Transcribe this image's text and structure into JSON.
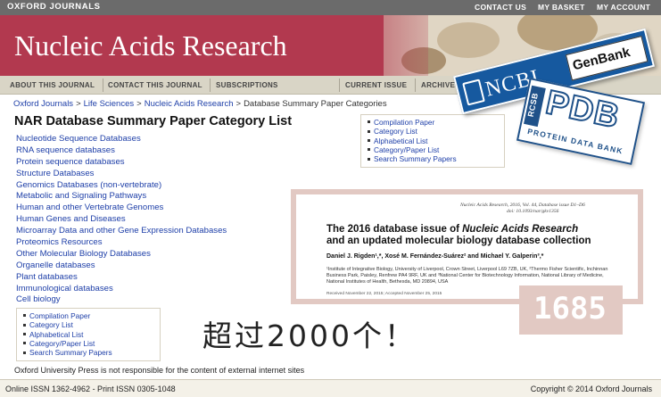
{
  "top_bar": {
    "brand": "OXFORD JOURNALS",
    "links": [
      "CONTACT US",
      "MY BASKET",
      "MY ACCOUNT"
    ]
  },
  "banner": {
    "journal_title": "Nucleic Acids Research"
  },
  "nav_bar": {
    "items": [
      "ABOUT THIS JOURNAL",
      "CONTACT THIS JOURNAL",
      "SUBSCRIPTIONS",
      "CURRENT ISSUE",
      "ARCHIVE"
    ]
  },
  "breadcrumb": {
    "items": [
      "Oxford Journals",
      "Life Sciences",
      "Nucleic Acids Research"
    ],
    "current": "Database Summary Paper Categories",
    "separator": ">"
  },
  "page_title": "NAR Database Summary Paper Category List",
  "categories": [
    "Nucleotide Sequence Databases",
    "RNA sequence databases",
    "Protein sequence databases",
    "Structure Databases",
    "Genomics Databases (non-vertebrate)",
    "Metabolic and Signaling Pathways",
    "Human and other Vertebrate Genomes",
    "Human Genes and Diseases",
    "Microarray Data and other Gene Expression Databases",
    "Proteomics Resources",
    "Other Molecular Biology Databases",
    "Organelle databases",
    "Plant databases",
    "Immunological databases",
    "Cell biology"
  ],
  "quick_links": [
    "Compilation Paper",
    "Category List",
    "Alphabetical List",
    "Category/Paper List",
    "Search Summary Papers"
  ],
  "disclaimer": "Oxford University Press is not responsible for the content of external internet sites",
  "footer": {
    "issn": "Online ISSN 1362-4962 - Print ISSN 0305-1048",
    "copyright": "Copyright © 2014 Oxford Journals"
  },
  "logos": {
    "ncbi": "NCBI",
    "genbank": "GenBank",
    "pdb": "PDB",
    "rcsb": "RCSB",
    "pdb_subtitle": "PROTEIN DATA BANK"
  },
  "paper_excerpt": {
    "header_line1": "Nucleic Acids Research, 2016, Vol. 44, Database issue    D1–D6",
    "header_line2": "doi: 10.1093/nar/gkv1356",
    "title_pre": "The 2016 database issue of ",
    "title_journal": "Nucleic Acids Research",
    "title_line2": "and an updated molecular biology database collection",
    "authors": "Daniel J. Rigden¹,*, Xosé M. Fernández-Suárez² and Michael Y. Galperin³,*",
    "affiliations": "¹Institute of Integrative Biology, University of Liverpool, Crown Street, Liverpool L69 7ZB, UK, ²Thermo Fisher Scientific, Inchinnan Business Park, Paisley, Renfrew PA4 9RF, UK and ³National Center for Biotechnology Information, National Library of Medicine, National Institutes of Health, Bethesda, MD 20894, USA",
    "received": "Received November 22, 2015; Accepted November 25, 2015"
  },
  "annotations": {
    "count_stamp": "1685",
    "handwritten_note": "超过2000个！"
  },
  "colors": {
    "banner": "#b2394f",
    "link": "#1e3fa8",
    "topbar": "#6b6b6b",
    "navbar": "#d9d5c6",
    "ncbi_blue": "#16599f",
    "pdb_blue": "#1f5189",
    "stamp": "#e2c9c3"
  }
}
